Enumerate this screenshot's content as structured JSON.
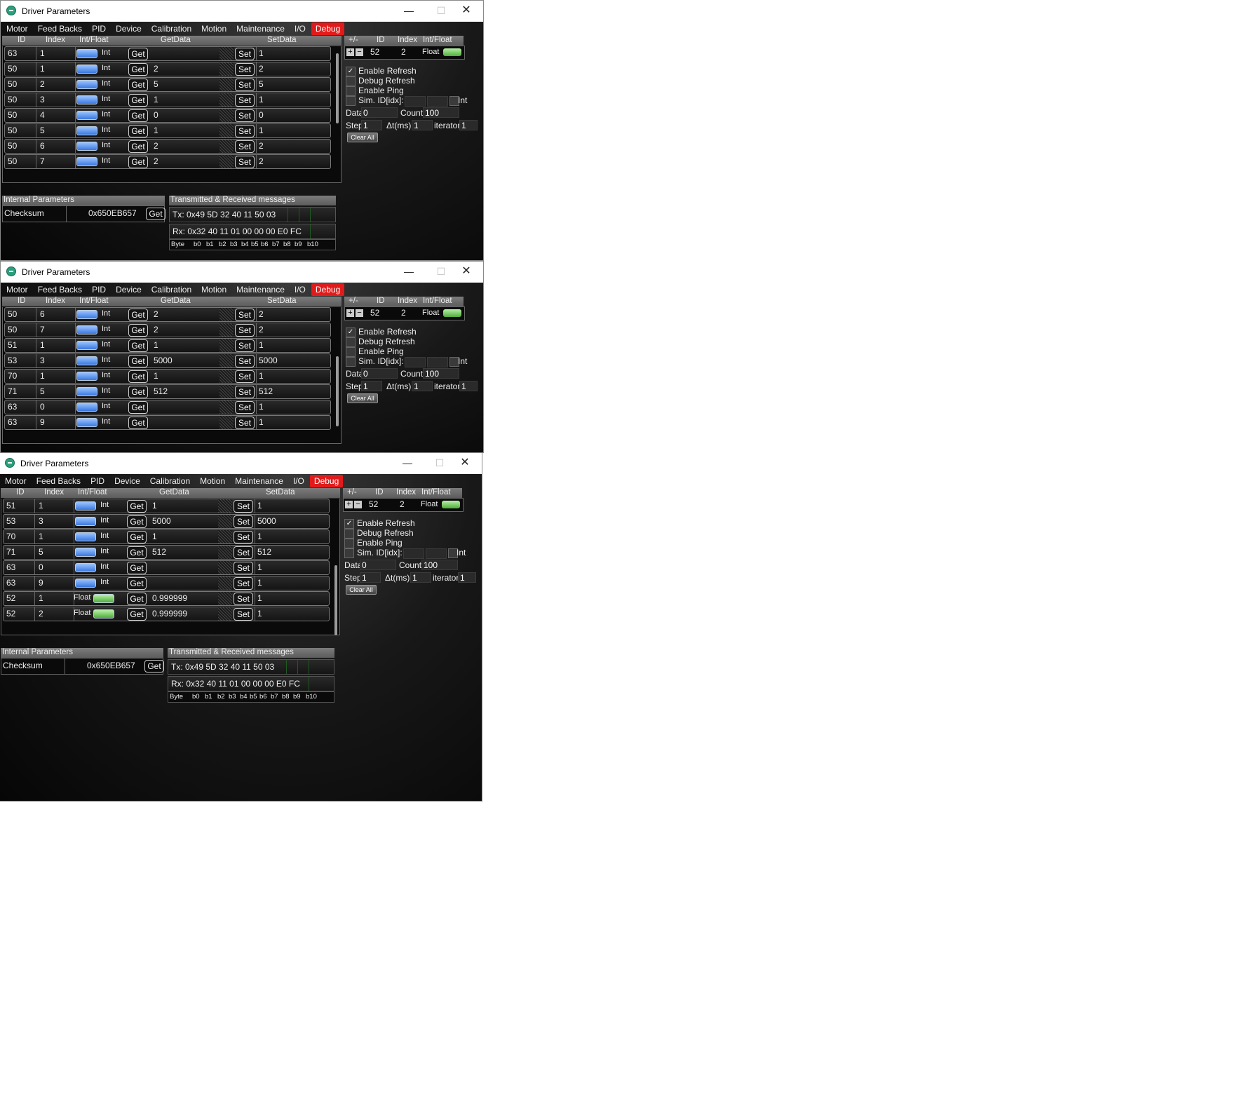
{
  "window": {
    "title": "Driver Parameters",
    "minimize": "—",
    "maximize": "☐",
    "close": "✕"
  },
  "menu": [
    "Motor",
    "Feed Backs",
    "PID",
    "Device",
    "Calibration",
    "Motion",
    "Maintenance",
    "I/O",
    "Debug"
  ],
  "grid_headers": {
    "id": "ID",
    "index": "Index",
    "intfloat": "Int/Float",
    "getdata": "GetData",
    "setdata": "SetData"
  },
  "get_label": "Get",
  "set_label": "Set",
  "int_label": "Int",
  "float_label": "Float",
  "windows": [
    {
      "rows": [
        {
          "id": "63",
          "index": "1",
          "type": "Int",
          "get": "",
          "set": "1"
        },
        {
          "id": "50",
          "index": "1",
          "type": "Int",
          "get": "2",
          "set": "2"
        },
        {
          "id": "50",
          "index": "2",
          "type": "Int",
          "get": "5",
          "set": "5"
        },
        {
          "id": "50",
          "index": "3",
          "type": "Int",
          "get": "1",
          "set": "1"
        },
        {
          "id": "50",
          "index": "4",
          "type": "Int",
          "get": "0",
          "set": "0"
        },
        {
          "id": "50",
          "index": "5",
          "type": "Int",
          "get": "1",
          "set": "1"
        },
        {
          "id": "50",
          "index": "6",
          "type": "Int",
          "get": "2",
          "set": "2"
        },
        {
          "id": "50",
          "index": "7",
          "type": "Int",
          "get": "2",
          "set": "2"
        }
      ]
    },
    {
      "rows": [
        {
          "id": "50",
          "index": "6",
          "type": "Int",
          "get": "2",
          "set": "2"
        },
        {
          "id": "50",
          "index": "7",
          "type": "Int",
          "get": "2",
          "set": "2"
        },
        {
          "id": "51",
          "index": "1",
          "type": "Int",
          "get": "1",
          "set": "1"
        },
        {
          "id": "53",
          "index": "3",
          "type": "Int",
          "get": "5000",
          "set": "5000"
        },
        {
          "id": "70",
          "index": "1",
          "type": "Int",
          "get": "1",
          "set": "1"
        },
        {
          "id": "71",
          "index": "5",
          "type": "Int",
          "get": "512",
          "set": "512"
        },
        {
          "id": "63",
          "index": "0",
          "type": "Int",
          "get": "",
          "set": "1"
        },
        {
          "id": "63",
          "index": "9",
          "type": "Int",
          "get": "",
          "set": "1"
        }
      ]
    },
    {
      "rows": [
        {
          "id": "51",
          "index": "1",
          "type": "Int",
          "get": "1",
          "set": "1"
        },
        {
          "id": "53",
          "index": "3",
          "type": "Int",
          "get": "5000",
          "set": "5000"
        },
        {
          "id": "70",
          "index": "1",
          "type": "Int",
          "get": "1",
          "set": "1"
        },
        {
          "id": "71",
          "index": "5",
          "type": "Int",
          "get": "512",
          "set": "512"
        },
        {
          "id": "63",
          "index": "0",
          "type": "Int",
          "get": "",
          "set": "1"
        },
        {
          "id": "63",
          "index": "9",
          "type": "Int",
          "get": "",
          "set": "1"
        },
        {
          "id": "52",
          "index": "1",
          "type": "Float",
          "get": "0.999999",
          "set": "1"
        },
        {
          "id": "52",
          "index": "2",
          "type": "Float",
          "get": "0.999999",
          "set": "1"
        }
      ]
    }
  ],
  "right_panel": {
    "headers": {
      "pm": "+/-",
      "id": "ID",
      "index": "Index",
      "intfloat": "Int/Float"
    },
    "plus": "+",
    "minus": "−",
    "id_value": "52",
    "index_value": "2",
    "type_label": "Float",
    "enable_refresh": "Enable Refresh",
    "debug_refresh": "Debug Refresh",
    "enable_ping": "Enable Ping",
    "sim_label": "Sim. ID[idx]:",
    "sim_int": "Int",
    "data_label": "Data",
    "data_value": "0",
    "count_label": "Count",
    "count_value": "100",
    "step_label": "Step",
    "step_value": "1",
    "dt_label": "Δt(ms)",
    "dt_value": "1",
    "iterator_label": "iterator",
    "iterator_value": "1",
    "clear_all": "Clear All",
    "check": "✓"
  },
  "internal": {
    "title": "Internal Parameters",
    "checksum_label": "Checksum",
    "checksum_value": "0x650EB657",
    "get": "Get"
  },
  "messages": {
    "title": "Transmitted & Received messages",
    "tx": "Tx: 0x49 5D 32 40 11 50 03",
    "rx": "Rx: 0x32 40 11 01 00 00 00 E0 FC",
    "bytes": [
      "Byte",
      "b0",
      "b1",
      "b2",
      "b3",
      "b4",
      "b5",
      "b6",
      "b7",
      "b8",
      "b9",
      "b10"
    ]
  }
}
